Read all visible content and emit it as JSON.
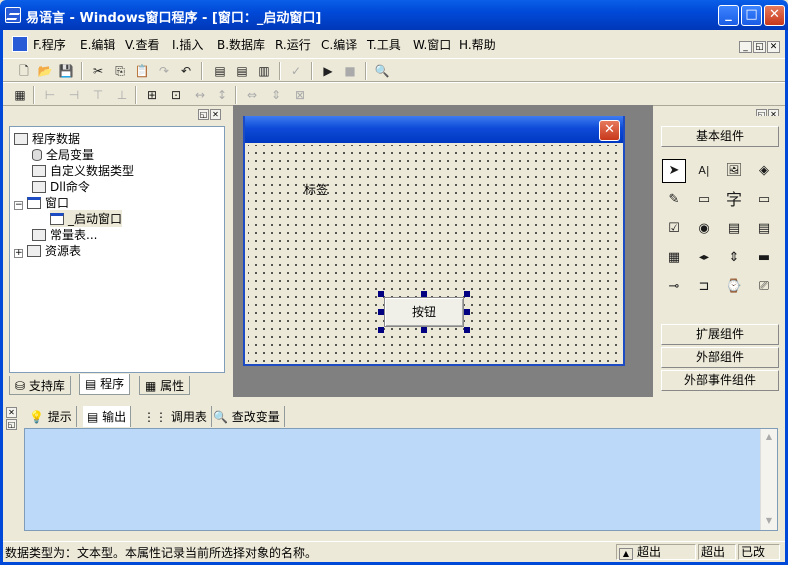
{
  "window": {
    "title": "易语言 - Windows窗口程序 - [窗口：_启动窗口]"
  },
  "menu": [
    "F.程序",
    "E.编辑",
    "V.查看",
    "I.插入",
    "B.数据库",
    "R.运行",
    "C.编译",
    "T.工具",
    "W.窗口",
    "H.帮助"
  ],
  "tree": {
    "root": "程序数据",
    "items": [
      "全局变量",
      "自定义数据类型",
      "Dll命令",
      "窗口",
      "_启动窗口",
      "常量表...",
      "资源表"
    ]
  },
  "left_tabs": [
    "支持库",
    "程序",
    "属性"
  ],
  "form": {
    "label_text": "标签",
    "button_text": "按钮"
  },
  "right_panel": {
    "basic": "基本组件",
    "extended": "扩展组件",
    "external": "外部组件",
    "external_event": "外部事件组件"
  },
  "bottom_tabs": [
    "提示",
    "输出",
    "调用表",
    "查改变量"
  ],
  "status": {
    "message": "数据类型为：文本型。本属性记录当前所选择对象的名称。",
    "cell1": "超出",
    "cell2": "超出",
    "cell3": "已改"
  },
  "colors": {
    "titlebar": "#0A5FE8",
    "output_bg": "#BDD9F9",
    "design_bg": "#808080"
  }
}
